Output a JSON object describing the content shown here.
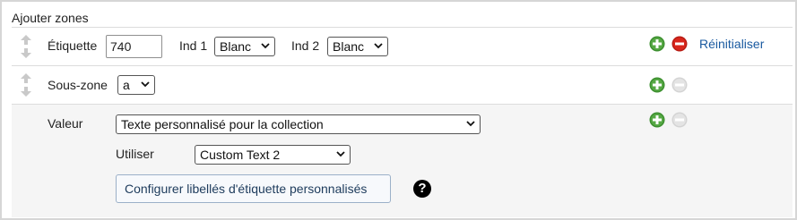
{
  "heading": "Ajouter zones",
  "row_tag": {
    "etiquette_label": "Étiquette",
    "etiquette_value": "740",
    "ind1_label": "Ind 1",
    "ind1_value": "Blanc",
    "ind2_label": "Ind 2",
    "ind2_value": "Blanc",
    "reset_label": "Réinitialiser"
  },
  "row_subfield": {
    "label": "Sous-zone",
    "value": "a"
  },
  "row_value": {
    "label": "Valeur",
    "value_select": "Texte personnalisé pour la collection",
    "use_label": "Utiliser",
    "use_select": "Custom Text 2",
    "configure_button": "Configurer libellés d'étiquette personnalisés",
    "help_glyph": "?"
  },
  "colors": {
    "add_green": "#3c8f2f",
    "remove_red": "#d9261c",
    "disabled_gray": "#c8c8c8",
    "link_blue": "#1a5aa0",
    "row_alt_bg": "#f5f5f5"
  },
  "icons": [
    "drag-handle-icon",
    "add-icon",
    "remove-icon",
    "chevron-down-icon",
    "help-icon"
  ]
}
